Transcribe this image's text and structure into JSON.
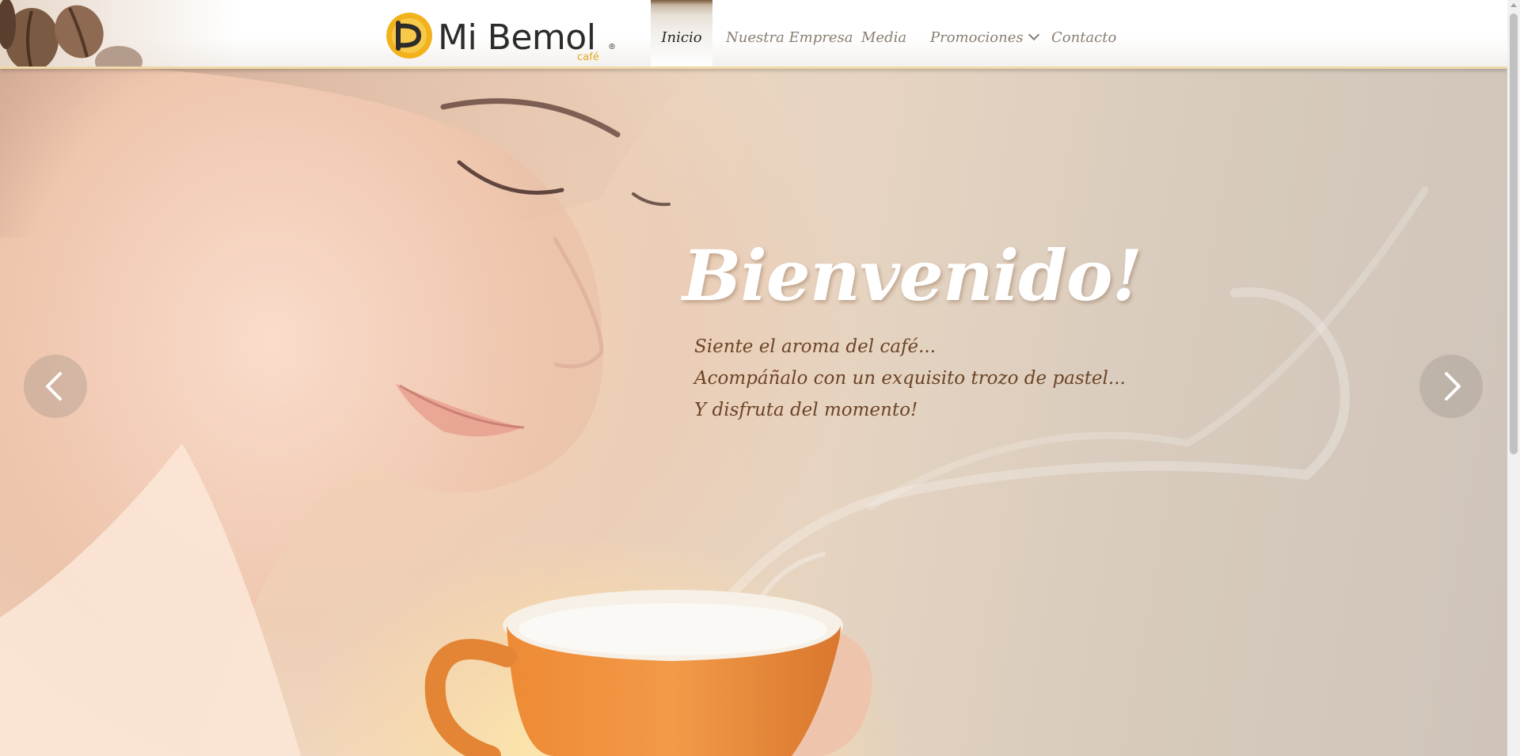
{
  "header": {
    "logo": {
      "name": "Mi Bemol",
      "registered": "®",
      "sub": "café",
      "accent_color": "#f2b21b"
    },
    "nav": [
      {
        "label": "Inicio",
        "active": true
      },
      {
        "label": "Nuestra Empresa",
        "active": false
      },
      {
        "label": "Media",
        "active": false
      },
      {
        "label": "Promociones",
        "active": false,
        "icon": "chevron-down-icon"
      },
      {
        "label": "Contacto",
        "active": false
      }
    ]
  },
  "hero": {
    "title": "Bienvenido!",
    "lines": [
      "Siente el aroma del café...",
      "Acompáñalo con un exquisito trozo de pastel...",
      "Y disfruta del momento!"
    ],
    "prev_icon": "chevron-left-icon",
    "next_icon": "chevron-right-icon",
    "text_color": "#6b4426"
  }
}
